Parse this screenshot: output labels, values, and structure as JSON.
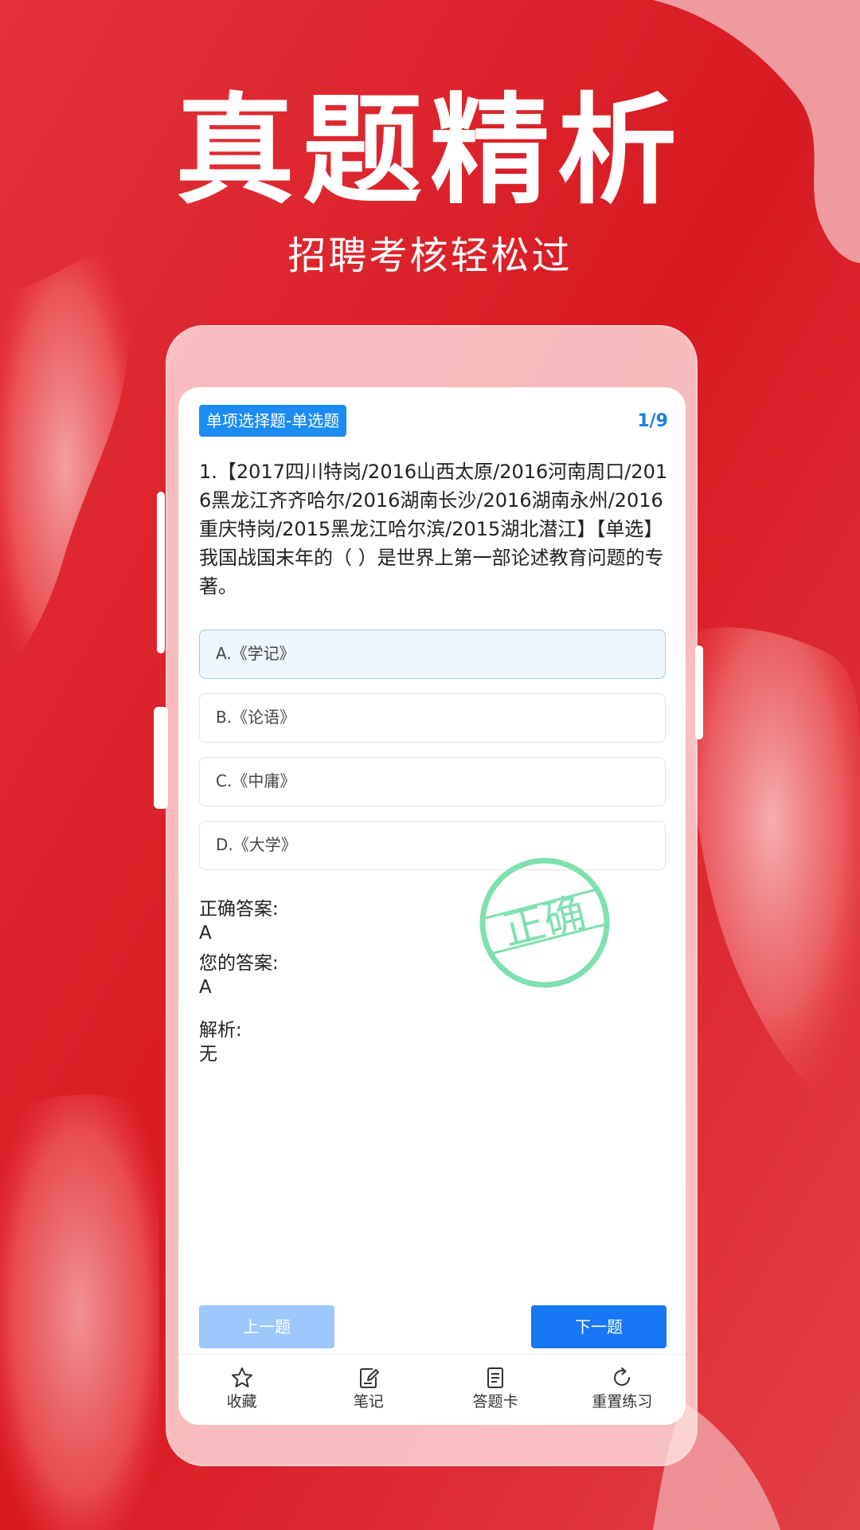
{
  "hero": {
    "title": "真题精析",
    "subtitle": "招聘考核轻松过"
  },
  "question": {
    "type_label": "单项选择题-单选题",
    "progress": "1/9",
    "text": "1.【2017四川特岗/2016山西太原/2016河南周口/2016黑龙江齐齐哈尔/2016湖南长沙/2016湖南永州/2016重庆特岗/2015黑龙江哈尔滨/2015湖北潜江】【单选】我国战国末年的（ ）是世界上第一部论述教育问题的专著。",
    "options": [
      {
        "label": "A.《学记》"
      },
      {
        "label": "B.《论语》"
      },
      {
        "label": "C.《中庸》"
      },
      {
        "label": "D.《大学》"
      }
    ],
    "selected_option": "A"
  },
  "answers": {
    "correct_label": "正确答案:",
    "correct_value": "A",
    "yours_label": "您的答案:",
    "yours_value": "A",
    "analysis_label": "解析:",
    "analysis_value": "无"
  },
  "stamp": {
    "text": "正确",
    "color": "#7fe0b0"
  },
  "navigation": {
    "prev_label": "上一题",
    "next_label": "下一题"
  },
  "tabbar": {
    "items": [
      {
        "label": "收藏",
        "icon": "star-icon"
      },
      {
        "label": "笔记",
        "icon": "note-icon"
      },
      {
        "label": "答题卡",
        "icon": "answer-sheet-icon"
      },
      {
        "label": "重置练习",
        "icon": "refresh-icon"
      }
    ]
  },
  "colors": {
    "background": "#dd1f26",
    "accent": "#1877f2",
    "badge": "#1c8cf2"
  }
}
